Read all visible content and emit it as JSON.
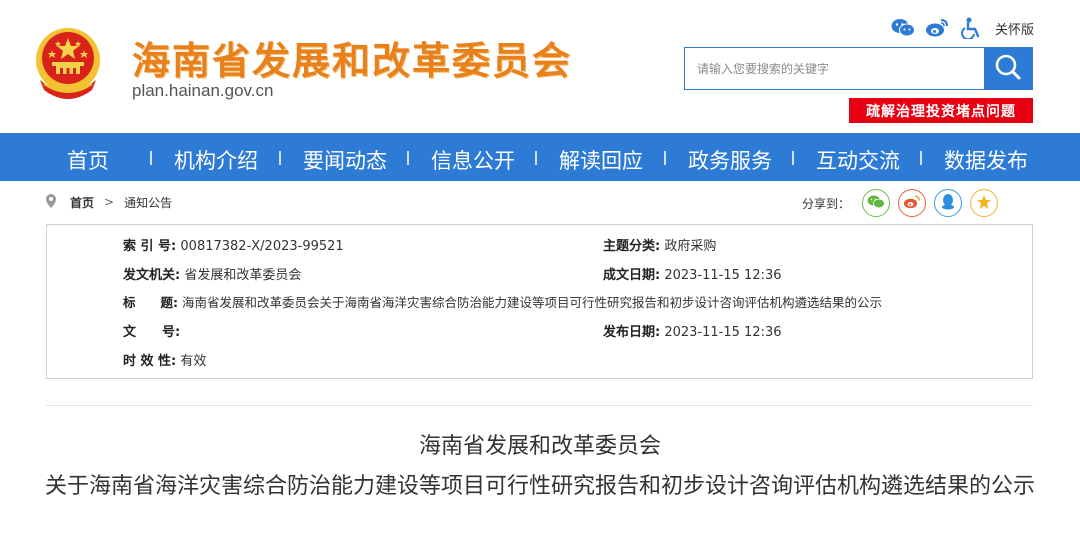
{
  "site": {
    "title": "海南省发展和改革委员会",
    "domain": "plan.hainan.gov.cn"
  },
  "tools": {
    "icons": [
      "wechat-icon",
      "weibo-icon",
      "accessibility-icon"
    ],
    "care_mode": "关怀版"
  },
  "search": {
    "placeholder": "请输入您要搜索的关键字"
  },
  "banner": {
    "label": "疏解治理投资堵点问题"
  },
  "nav": {
    "items": [
      "首页",
      "机构介绍",
      "要闻动态",
      "信息公开",
      "解读回应",
      "政务服务",
      "互动交流",
      "数据发布"
    ]
  },
  "breadcrumb": {
    "home": "首页",
    "current": "通知公告"
  },
  "share": {
    "label": "分享到：",
    "icons": [
      "wechat-icon",
      "weibo-icon",
      "qq-icon",
      "qzone-icon"
    ]
  },
  "meta": {
    "index_label": "索 引 号:",
    "index_value": "00817382-X/2023-99521",
    "topic_label": "主题分类:",
    "topic_value": "政府采购",
    "issuer_label": "发文机关:",
    "issuer_value": "省发展和改革委员会",
    "date_label": "成文日期:",
    "date_value": "2023-11-15 12:36",
    "title_label": "标　　题:",
    "title_value": "海南省发展和改革委员会关于海南省海洋灾害综合防治能力建设等项目可行性研究报告和初步设计咨询评估机构遴选结果的公示",
    "docno_label": "文　　号:",
    "docno_value": "",
    "pubdate_label": "发布日期:",
    "pubdate_value": "2023-11-15 12:36",
    "validity_label": "时 效 性:",
    "validity_value": "有效"
  },
  "article": {
    "org": "海南省发展和改革委员会",
    "title": "关于海南省海洋灾害综合防治能力建设等项目可行性研究报告和初步设计咨询评估机构遴选结果的公示"
  },
  "colors": {
    "brand_blue": "#2e7bd6",
    "title_orange": "#e8811c",
    "banner_red": "#e60012"
  }
}
